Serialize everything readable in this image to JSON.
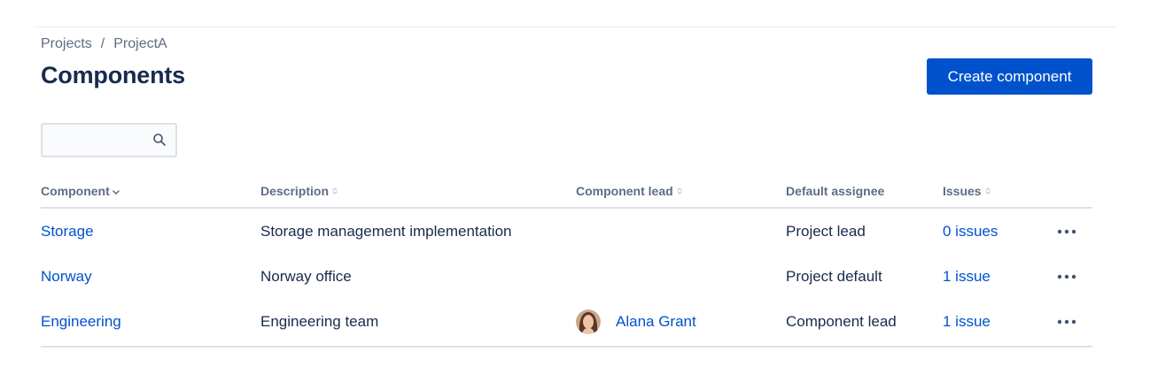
{
  "breadcrumb": {
    "items": [
      "Projects",
      "ProjectA"
    ],
    "separator": "/"
  },
  "page": {
    "title": "Components",
    "create_button_label": "Create component"
  },
  "search": {
    "value": "",
    "placeholder": "",
    "icon": "search-icon"
  },
  "table": {
    "headers": {
      "component": "Component",
      "description": "Description",
      "component_lead": "Component lead",
      "default_assignee": "Default assignee",
      "issues": "Issues"
    },
    "sort": {
      "active_column": "component",
      "direction": "descending",
      "sortable_columns": [
        "component",
        "description",
        "component_lead",
        "issues"
      ]
    },
    "rows": [
      {
        "component": "Storage",
        "description": "Storage management implementation",
        "lead": "",
        "default_assignee": "Project lead",
        "issues": "0 issues"
      },
      {
        "component": "Norway",
        "description": "Norway office",
        "lead": "",
        "default_assignee": "Project default",
        "issues": "1 issue"
      },
      {
        "component": "Engineering",
        "description": "Engineering team",
        "lead": "Alana Grant",
        "default_assignee": "Component lead",
        "issues": "1 issue"
      }
    ]
  },
  "colors": {
    "primary": "#0052cc",
    "text": "#172b4d",
    "subtle_text": "#5e6c84",
    "border": "#dfe1e6"
  }
}
